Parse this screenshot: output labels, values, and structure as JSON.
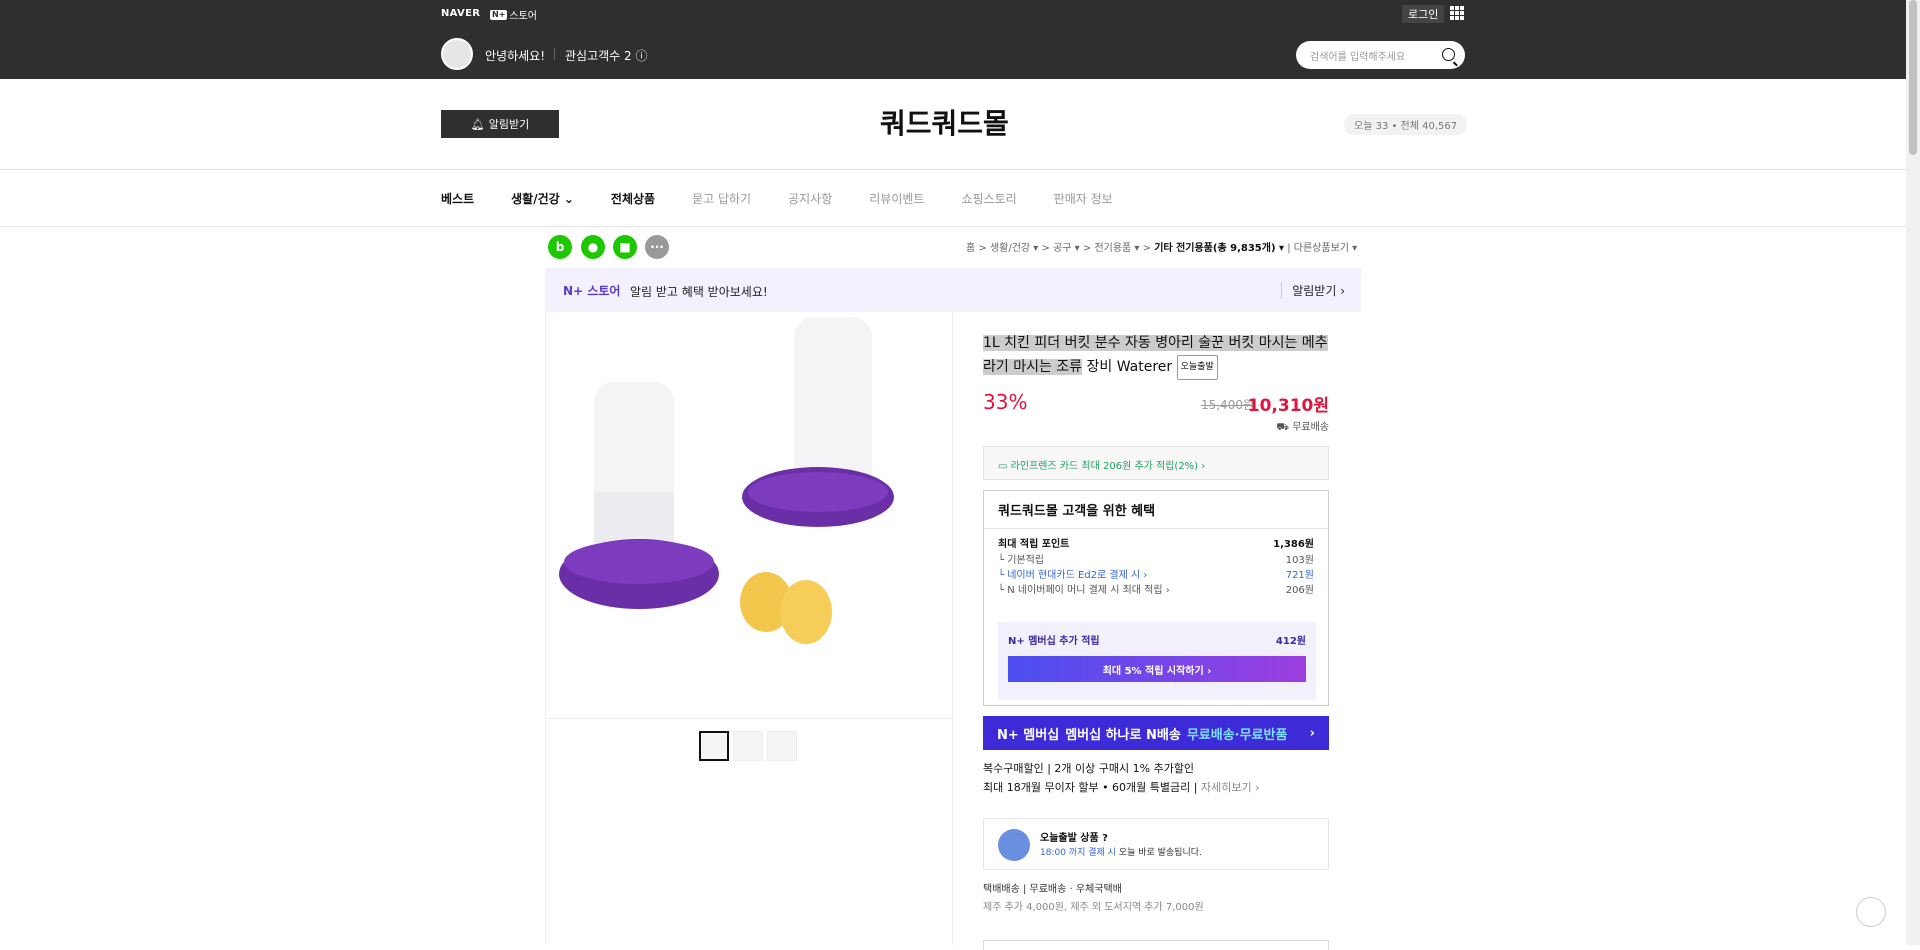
{
  "topbar": {
    "naver_logo": "NAVER",
    "nstore_badge": "N+",
    "nstore_label": "스토어",
    "login": "로그인",
    "greeting": "안녕하세요!",
    "interest": "관심고객수 2 ⓘ",
    "search_placeholder": "검색어를 입력해주세요"
  },
  "header": {
    "alarm_button": "알림받기",
    "store_name": "쿼드쿼드몰",
    "visitors": "오늘 33 • 전체 40,567"
  },
  "nav": {
    "items": [
      {
        "label": "베스트"
      },
      {
        "label": "생활/건강 ⌄"
      },
      {
        "label": "전체상품"
      },
      {
        "label": "묻고 답하기"
      },
      {
        "label": "공지사항"
      },
      {
        "label": "리뷰이벤트"
      },
      {
        "label": "쇼핑스토리"
      },
      {
        "label": "판매자 정보"
      }
    ]
  },
  "breadcrumb": {
    "items": [
      "홈",
      "생활/건강 ▾",
      "공구 ▾",
      "전기용품 ▾"
    ],
    "current": "기타 전기용품(총 9,835개) ▾",
    "other": "다른상품보기 ▾"
  },
  "promo": {
    "logo": "N+ 스토어",
    "text": "알림 받고 혜택 받아보세요!",
    "alarm": "알림받기 ›"
  },
  "product": {
    "title_hl": "1L 치킨 피더 버킷 분수 자동 병아리 술꾼 버킷 마시는 메추라기 마시는 조류",
    "title_rest": " 장비 Waterer ",
    "today_badge": "오늘출발",
    "discount": "33%",
    "original_price": "15,400원",
    "sale_price": "10,310원",
    "shipping": "무료배송",
    "card_benefit": "라인프렌즈 카드 최대 206원 추가 적립(2%) ›"
  },
  "benefits": {
    "title": "쿼드쿼드몰 고객을 위한 혜택",
    "max_points_label": "최대 적립 포인트",
    "max_points": "1,386원",
    "rows": [
      {
        "label": "└ 기본적립",
        "value": "103원"
      },
      {
        "label": "└ 네이버 현대카드 Ed2로 결제 시 ›",
        "value": "721원"
      },
      {
        "label": "└ N 네이버페이 머니 결제 시 최대 적립 ›",
        "value": "206원"
      }
    ],
    "membership_label": "N+ 멤버십 추가 적립",
    "membership_amount": "412원",
    "membership_button": "최대 5% 적립 시작하기 ›"
  },
  "membership_banner": {
    "prefix": "N+ 멤버십",
    "text": "멤버십 하나로 N배송",
    "emphasis": "무료배송·무료반품",
    "arrow": "›"
  },
  "multi_discount": "복수구매할인 | 2개 이상 구매시 1% 추가할인",
  "installment": {
    "text": "최대 18개월 무이자 할부 • 60개월 특별금리 | ",
    "more": "자세히보기 ›"
  },
  "today_ship": {
    "title": "오늘출발 상품 ?",
    "time": "18:00 까지 결제 시",
    "sub": " 오늘 바로 발송됩니다."
  },
  "courier": "택배배송 | 무료배송 · 우체국택배",
  "jeju": "제주 추가 4,000원, 제주 외 도서지역 추가 7,000원",
  "colors": {
    "accent": "#e0143c",
    "brand": "#3d2bd8",
    "topbar": "#2f2f2f"
  }
}
